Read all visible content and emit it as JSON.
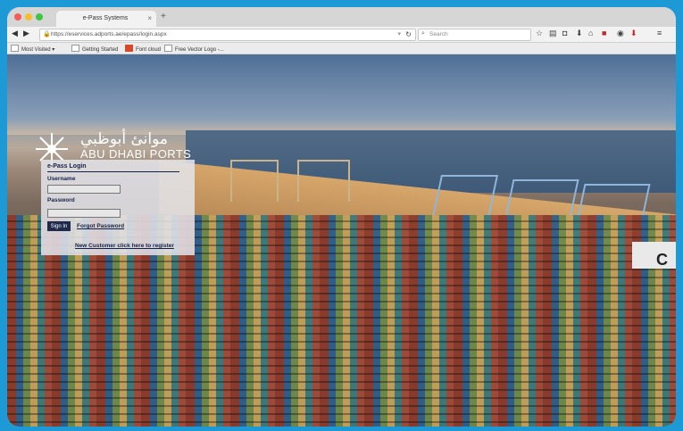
{
  "browser": {
    "tab_title": "e-Pass Systems",
    "tab_close": "×",
    "new_tab": "+",
    "url": "https://eservices.adports.ae/epass/login.aspx",
    "search_placeholder": "Search",
    "bookmarks": [
      "Most Visited",
      "Getting Started",
      "Font cloud",
      "Free Vector Logo -..."
    ]
  },
  "logo": {
    "arabic": "موانئ أبوظبي",
    "english": "ABU DHABI PORTS"
  },
  "login": {
    "title": "e-Pass Login",
    "username_label": "Username",
    "username_value": "",
    "password_label": "Password",
    "password_value": "",
    "signin_label": "Sign In",
    "forgot_label": "Forgot Password",
    "new_customer_label": "New Customer click here to register"
  },
  "scene": {
    "ship_letter": "C"
  }
}
